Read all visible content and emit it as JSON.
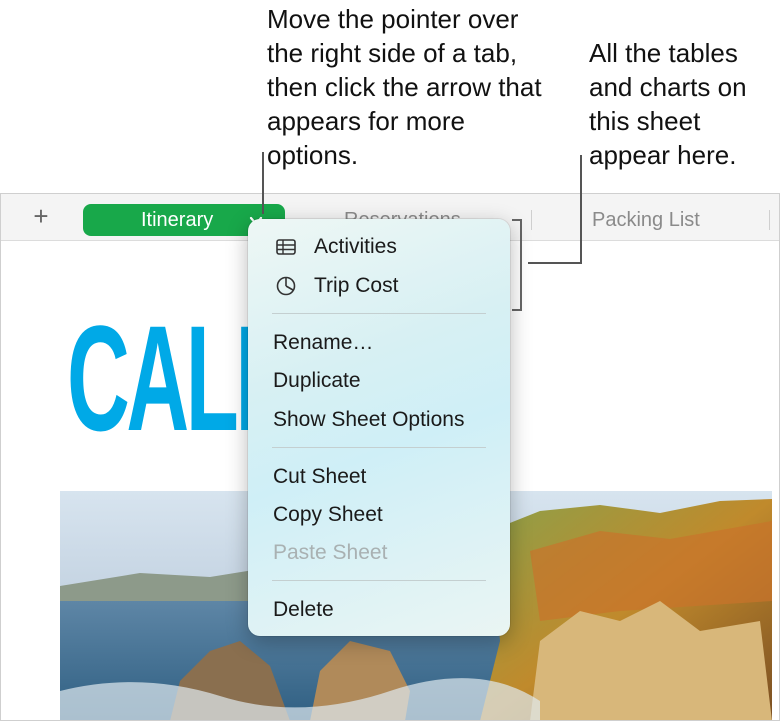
{
  "callouts": {
    "tab_menu_hint": "Move the pointer over the right side of a tab, then click the arrow that appears for more options.",
    "tables_charts_hint": "All the tables and charts on this sheet appear here."
  },
  "tabbar": {
    "add_label": "+",
    "active_tab": "Itinerary",
    "tabs": [
      "Reservations",
      "Packing List"
    ]
  },
  "document": {
    "headline": "CALIF"
  },
  "menu": {
    "objects": [
      {
        "label": "Activities",
        "icon": "table-icon"
      },
      {
        "label": "Trip Cost",
        "icon": "pie-chart-icon"
      }
    ],
    "sheet_actions": [
      "Rename…",
      "Duplicate",
      "Show Sheet Options"
    ],
    "clipboard": [
      {
        "label": "Cut Sheet",
        "enabled": true
      },
      {
        "label": "Copy Sheet",
        "enabled": true
      },
      {
        "label": "Paste Sheet",
        "enabled": false
      }
    ],
    "delete_label": "Delete"
  },
  "colors": {
    "active_tab": "#18a84a",
    "headline": "#00a9e7",
    "disabled_text": "#a9b1b2"
  }
}
